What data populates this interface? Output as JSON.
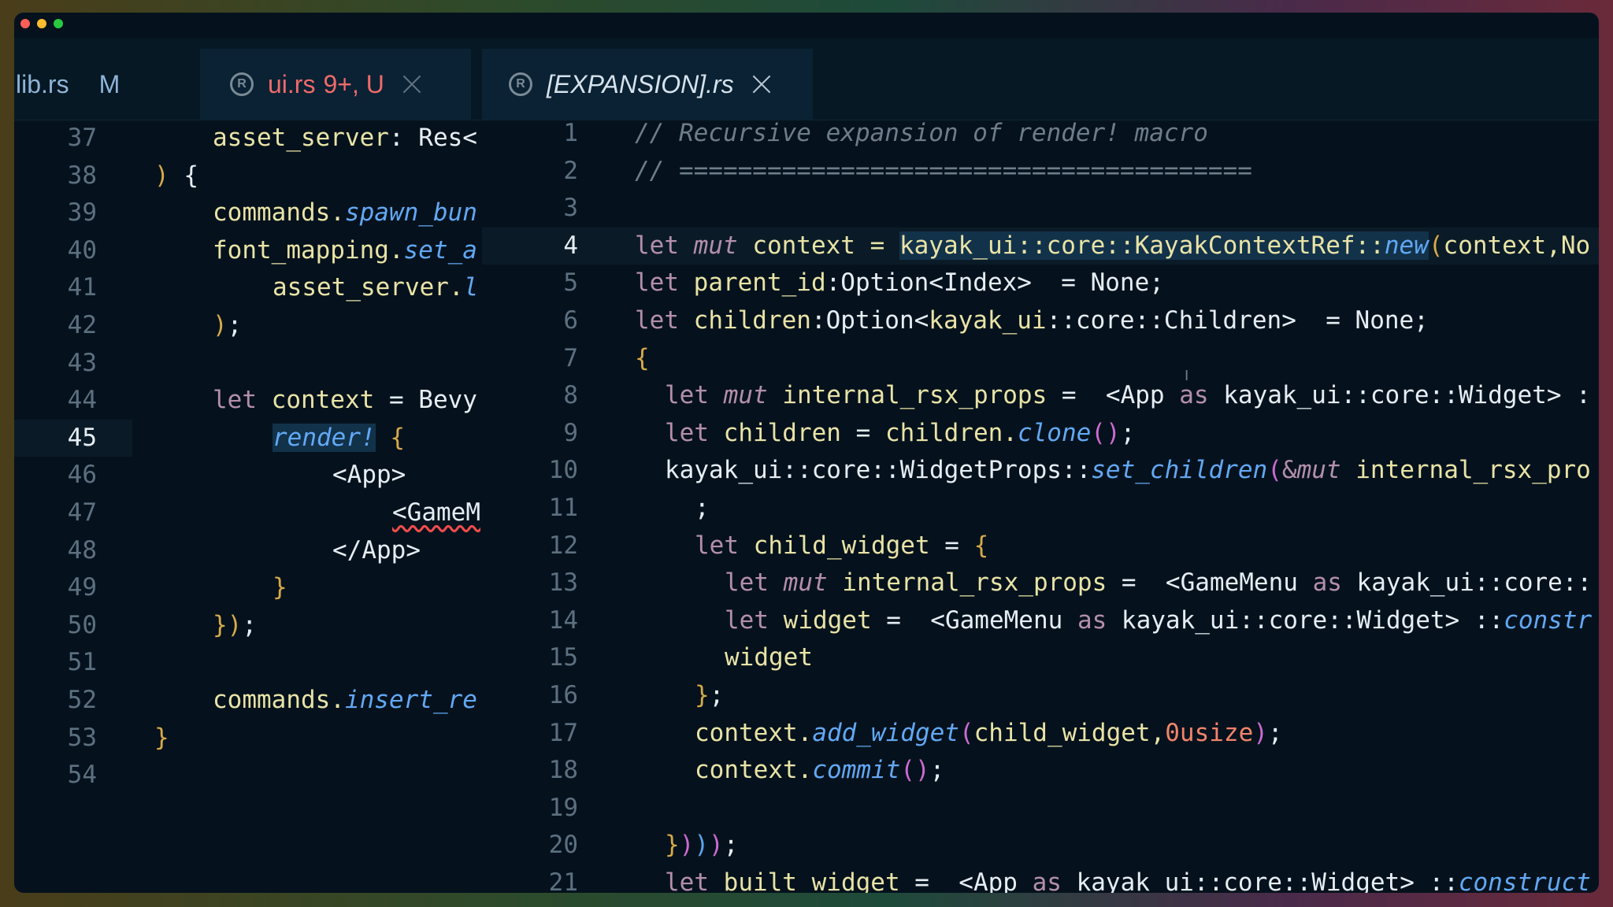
{
  "tabs": [
    {
      "name": "lib.rs",
      "badge": "M"
    },
    {
      "name": "ui.rs",
      "status": "9+, U",
      "icon": "rust-icon"
    },
    {
      "name": "[EXPANSION].rs",
      "icon": "rust-icon"
    }
  ],
  "left_editor": {
    "current_line": "45",
    "lines": [
      {
        "n": "37"
      },
      {
        "n": "38"
      },
      {
        "n": "39"
      },
      {
        "n": "40"
      },
      {
        "n": "41"
      },
      {
        "n": "42"
      },
      {
        "n": "43"
      },
      {
        "n": "44"
      },
      {
        "n": "45"
      },
      {
        "n": "46"
      },
      {
        "n": "47"
      },
      {
        "n": "48"
      },
      {
        "n": "49"
      },
      {
        "n": "50"
      },
      {
        "n": "51"
      },
      {
        "n": "52"
      },
      {
        "n": "53"
      },
      {
        "n": "54"
      }
    ],
    "text": {
      "l37_a": "asset_server",
      "l37_b": ": Res<",
      "l38_a": ")",
      "l38_b": " {",
      "l39_a": "commands.",
      "l39_b": "spawn_bun",
      "l40_a": "font_mapping.",
      "l40_b": "set_a",
      "l41_a": "asset_server.",
      "l41_b": "l",
      "l42_a": ")",
      "l42_b": ";",
      "l44_a": "let ",
      "l44_b": "context",
      "l44_c": " = Bevy",
      "l45_a": "render!",
      "l45_b": " {",
      "l46": "<App>",
      "l47": "<GameM",
      "l48": "</App>",
      "l49": "}",
      "l50_a": "}",
      "l50_b": ")",
      "l50_c": ";",
      "l52_a": "commands.",
      "l52_b": "insert_re",
      "l53": "}"
    }
  },
  "right_editor": {
    "current_line": "4",
    "lines": [
      {
        "n": "1"
      },
      {
        "n": "2"
      },
      {
        "n": "3"
      },
      {
        "n": "4"
      },
      {
        "n": "5"
      },
      {
        "n": "6"
      },
      {
        "n": "7"
      },
      {
        "n": "8"
      },
      {
        "n": "9"
      },
      {
        "n": "10"
      },
      {
        "n": "11"
      },
      {
        "n": "12"
      },
      {
        "n": "13"
      },
      {
        "n": "14"
      },
      {
        "n": "15"
      },
      {
        "n": "16"
      },
      {
        "n": "17"
      },
      {
        "n": "18"
      },
      {
        "n": "19"
      },
      {
        "n": "20"
      },
      {
        "n": "21"
      }
    ],
    "text": {
      "r1": "// Recursive expansion of render! macro",
      "r2": "// =======================================",
      "r4_a": "let ",
      "r4_b": "mut",
      "r4_c": " context = ",
      "r4_d": "kayak_ui::core::KayakContextRef::",
      "r4_e": "new",
      "r4_f": "(",
      "r4_g": "context,No",
      "r5_a": "let ",
      "r5_b": "parent_id",
      "r5_c": ":Option<Index>  = None;",
      "r6_a": "let ",
      "r6_b": "children",
      "r6_c": ":Option<",
      "r6_d": "kayak_ui",
      "r6_e": "::core::Children>  = None;",
      "r7": "{",
      "r8_a": "let ",
      "r8_b": "mut",
      "r8_c": " internal_rsx_props",
      "r8_d": " =  <App ",
      "r8_e": "as",
      "r8_f": " kayak_ui::core::Widget> :",
      "r9_a": "let ",
      "r9_b": "children",
      "r9_c": " = ",
      "r9_d": "children.",
      "r9_e": "clone",
      "r9_f": "()",
      "r9_g": ";",
      "r10_a": "kayak_ui::core::WidgetProps::",
      "r10_b": "set_children",
      "r10_c": "(",
      "r10_d": "&",
      "r10_e": "mut",
      "r10_f": " internal_rsx_pro",
      "r11": ";",
      "r12_a": "let ",
      "r12_b": "child_widget",
      "r12_c": " = ",
      "r12_d": "{",
      "r13_a": "let ",
      "r13_b": "mut",
      "r13_c": " internal_rsx_props",
      "r13_d": " =  <GameMenu ",
      "r13_e": "as",
      "r13_f": " kayak_ui::core::",
      "r14_a": "let ",
      "r14_b": "widget",
      "r14_c": " =  <GameMenu ",
      "r14_d": "as",
      "r14_e": " kayak_ui::core::Widget> ::",
      "r14_f": "constr",
      "r15": "widget",
      "r16_a": "}",
      "r16_b": ";",
      "r17_a": "context.",
      "r17_b": "add_widget",
      "r17_c": "(",
      "r17_d": "child_widget,",
      "r17_e": "0usize",
      "r17_f": ")",
      "r17_g": ";",
      "r18_a": "context.",
      "r18_b": "commit",
      "r18_c": "()",
      "r18_d": ";",
      "r20_a": "}",
      "r20_b": ")",
      "r20_c": ")",
      "r20_d": ")",
      "r20_e": ";",
      "r21_a": "let ",
      "r21_b": "built_widget",
      "r21_c": " =  <App ",
      "r21_d": "as",
      "r21_e": " kayak_ui::core::Widget> ::",
      "r21_f": "construct"
    }
  }
}
